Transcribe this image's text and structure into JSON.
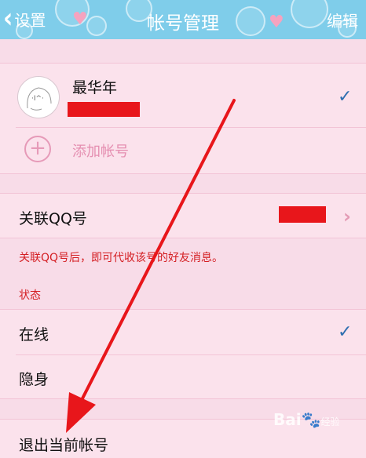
{
  "nav": {
    "back_label": "设置",
    "title": "帐号管理",
    "edit_label": "编辑"
  },
  "account": {
    "name": "最华年",
    "add_label": "添加帐号"
  },
  "link_qq": {
    "label": "关联QQ号",
    "hint": "关联QQ号后，即可代收该号的好友消息。"
  },
  "status": {
    "header": "状态",
    "options": [
      {
        "label": "在线",
        "selected": true
      },
      {
        "label": "隐身",
        "selected": false
      }
    ]
  },
  "logout_label": "退出当前帐号",
  "watermark": {
    "brand": "Bai",
    "suffix": "经验"
  },
  "colors": {
    "nav": "#7fcdea",
    "background": "#f8dce8",
    "check": "#2f6fb0",
    "annotation": "#e8161b"
  }
}
